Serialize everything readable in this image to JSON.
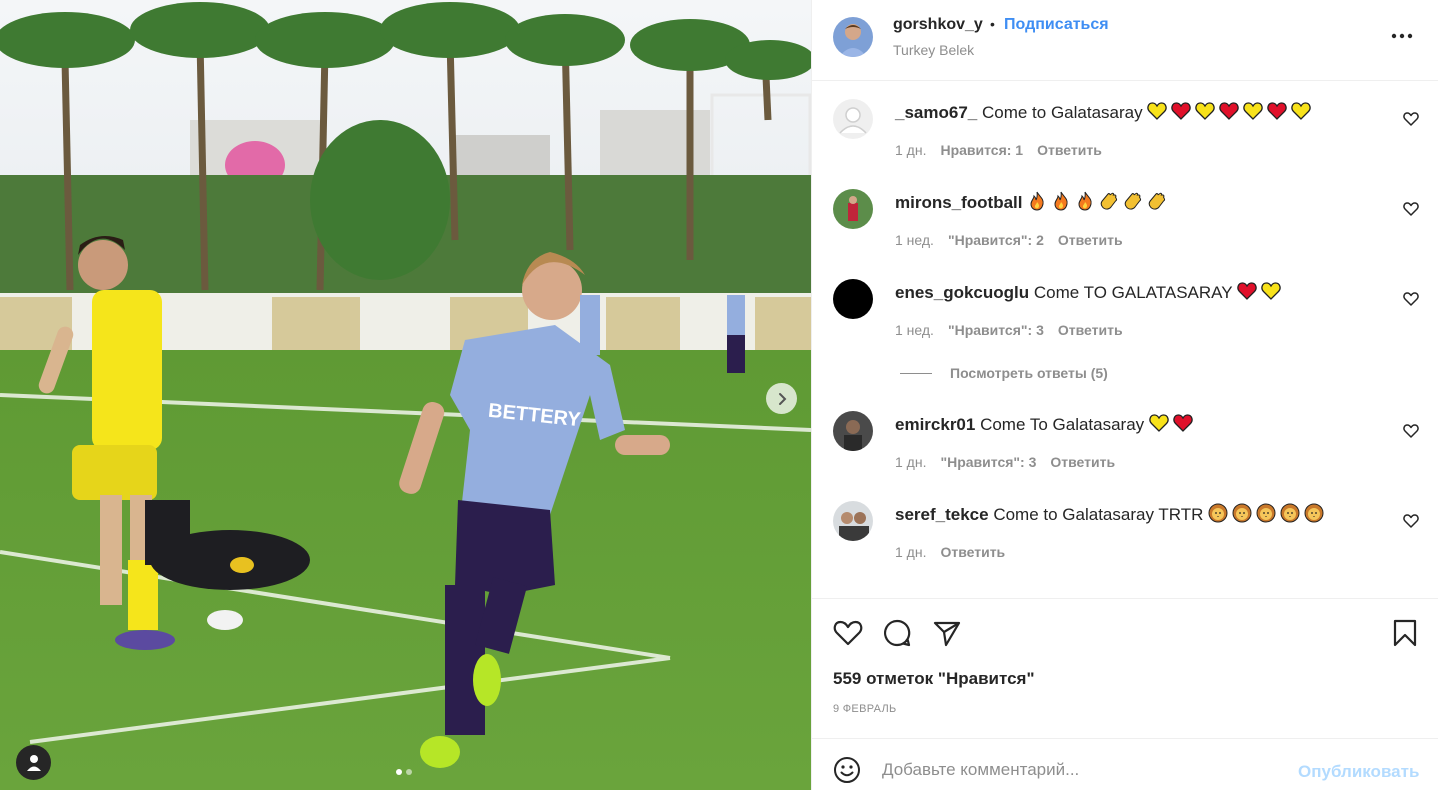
{
  "post": {
    "username": "gorshkov_y",
    "separator": "•",
    "follow_label": "Подписаться",
    "location": "Turkey Belek",
    "slide_count": 2,
    "active_slide": 0
  },
  "media": {
    "ad_board_text": "BETTERY",
    "next_icon": "chevron-right-icon",
    "tag_icon": "user-tag-icon"
  },
  "comments": [
    {
      "username": "_samo67_",
      "text": "Come to Galatasaray",
      "emojis": [
        "yellow-heart",
        "red-heart",
        "yellow-heart",
        "red-heart",
        "yellow-heart",
        "red-heart",
        "yellow-heart"
      ],
      "time": "1 дн.",
      "likes": "Нравится: 1",
      "reply": "Ответить"
    },
    {
      "username": "mirons_football",
      "text": "",
      "emojis": [
        "fire",
        "fire",
        "fire",
        "clap",
        "clap",
        "clap"
      ],
      "time": "1 нед.",
      "likes": "\"Нравится\": 2",
      "reply": "Ответить"
    },
    {
      "username": "enes_gokcuoglu",
      "text": "Come TO GALATASARAY",
      "emojis": [
        "red-heart",
        "yellow-heart"
      ],
      "time": "1 нед.",
      "likes": "\"Нравится\": 3",
      "reply": "Ответить"
    },
    {
      "username": "emirckr01",
      "text": "Come To Galatasaray",
      "emojis": [
        "yellow-heart",
        "red-heart"
      ],
      "time": "1 дн.",
      "likes": "\"Нравится\": 3",
      "reply": "Ответить"
    },
    {
      "username": "seref_tekce",
      "text": "Come to Galatasaray TRTR",
      "emojis": [
        "lion",
        "lion",
        "lion",
        "lion",
        "lion"
      ],
      "time": "1 дн.",
      "likes": "",
      "reply": "Ответить"
    }
  ],
  "view_replies_label": "Посмотреть ответы (5)",
  "likes_label": "559 отметок \"Нравится\"",
  "date_label": "9 ФЕВРАЛЬ",
  "add_comment": {
    "placeholder": "Добавьте комментарий...",
    "publish_label": "Опубликовать"
  },
  "colors": {
    "follow": "#3f8ef3",
    "publish_disabled": "#b3dbff",
    "muted": "#8e8e8e",
    "text": "#262626"
  }
}
